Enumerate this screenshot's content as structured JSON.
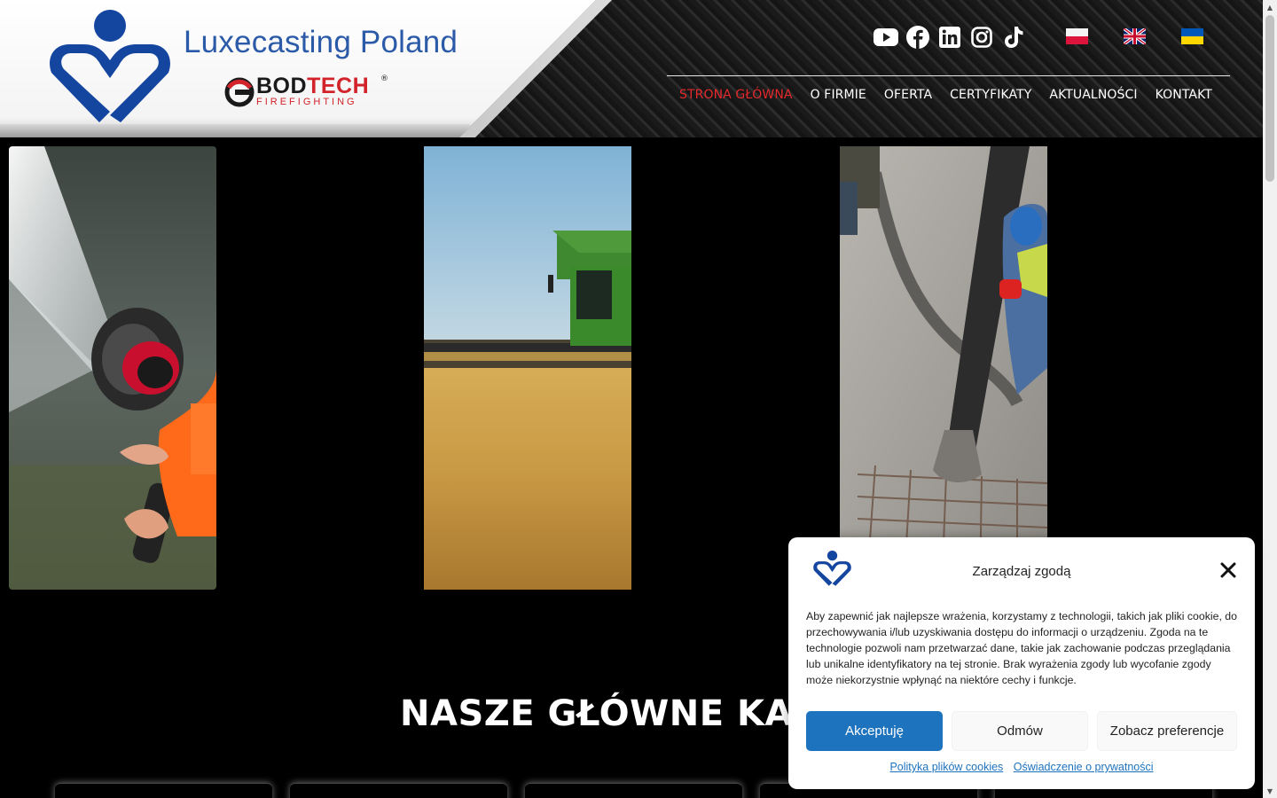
{
  "header": {
    "brand_title": "Luxecasting Poland",
    "partner_logo": {
      "word_black": "BOD",
      "word_red": "TECH",
      "sub": "FIREFIGHTING",
      "reg": "®"
    },
    "social_icons": [
      "youtube-icon",
      "facebook-icon",
      "linkedin-icon",
      "instagram-icon",
      "tiktok-icon"
    ],
    "languages": [
      "pl",
      "en",
      "uk"
    ],
    "nav": [
      {
        "label": "STRONA GŁÓWNA",
        "active": true
      },
      {
        "label": "O FIRMIE",
        "active": false
      },
      {
        "label": "OFERTA",
        "active": false
      },
      {
        "label": "CERTYFIKATY",
        "active": false
      },
      {
        "label": "AKTUALNOŚCI",
        "active": false
      },
      {
        "label": "KONTAKT",
        "active": false
      }
    ],
    "accent_color": "#e4282b",
    "brand_color": "#2b5ba8"
  },
  "hero": {
    "images": [
      "firefighter-nozzle-photo",
      "combine-harvester-photo",
      "concrete-pouring-photo"
    ]
  },
  "main": {
    "section_title": "NASZE GŁÓWNE KATAL"
  },
  "cookie_banner": {
    "title": "Zarządzaj zgodą",
    "text": "Aby zapewnić jak najlepsze wrażenia, korzystamy z technologii, takich jak pliki cookie, do przechowywania i/lub uzyskiwania dostępu do informacji o urządzeniu. Zgoda na te technologie pozwoli nam przetwarzać dane, takie jak zachowanie podczas przeglądania lub unikalne identyfikatory na tej stronie. Brak wyrażenia zgody lub wycofanie zgody może niekorzystnie wpłynąć na niektóre cechy i funkcje.",
    "accept_label": "Akceptuję",
    "deny_label": "Odmów",
    "prefs_label": "Zobacz preferencje",
    "cookie_policy_link": "Polityka plików cookies",
    "privacy_link": "Oświadczenie o prywatności",
    "primary_color": "#1e73be"
  }
}
